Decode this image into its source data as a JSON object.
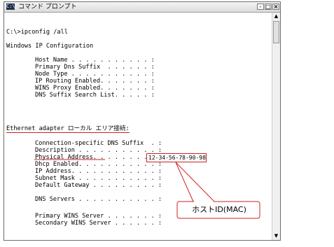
{
  "window": {
    "title": "コマンド プロンプト",
    "icon_text": "C:\\",
    "buttons": {
      "minimize": "-",
      "maximize": "□",
      "close": "×"
    }
  },
  "console": {
    "lines": [
      "C:\\>ipconfig /all",
      "Windows IP Configuration",
      "Host Name . . . . . . . . . . . :",
      "Primary Dns Suffix  . . . . . . :",
      "Node Type . . . . . . . . . . . :",
      "IP Routing Enabled. . . . . . . :",
      "WINS Proxy Enabled. . . . . . . :",
      "DNS Suffix Search List. . . . . :",
      "Ethernet adapter ローカル エリア接続:",
      "Connection-specific DNS Suffix  . :",
      "Description . . . . . . . . . . . :",
      "Physical Address. . . . . . . . . :",
      "Dhcp Enabled. . . . . . . . . . . :",
      "IP Address. . . . . . . . . . . . :",
      "Subnet Mask . . . . . . . . . . . :",
      "Default Gateway . . . . . . . . . :",
      "DNS Servers . . . . . . . . . . . :",
      "Primary WINS Server . . . . . . . :",
      "Secondary WINS Server . . . . . . :"
    ],
    "physical_address_value": "12-34-56-78-90-98"
  },
  "annotation": {
    "callout_label": "ホストID(MAC)",
    "color": "#cc2222"
  },
  "scrollbar": {
    "up_arrow": "▲",
    "down_arrow": "▼"
  }
}
